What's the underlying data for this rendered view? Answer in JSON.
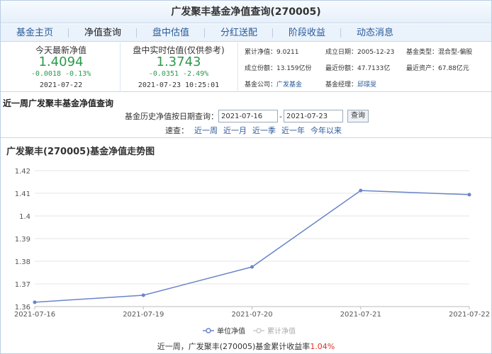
{
  "title": "广发聚丰基金净值查询(270005)",
  "nav": [
    "基金主页",
    "净值查询",
    "盘中估值",
    "分红送配",
    "阶段收益",
    "动态消息"
  ],
  "nav_active": 1,
  "today_nav": {
    "label": "今天最新净值",
    "value": "1.4094",
    "change": "-0.0018 -0.13%",
    "date": "2021-07-22"
  },
  "realtime_est": {
    "label": "盘中实时估值(仅供参考)",
    "value": "1.3743",
    "change": "-0.0351 -2.49%",
    "datetime": "2021-07-23 10:25:01"
  },
  "info": {
    "cum_nav_label": "累计净值：",
    "cum_nav": "9.0211",
    "found_date_label": "成立日期：",
    "found_date": "2005-12-23",
    "fund_type_label": "基金类型：",
    "fund_type": "混合型-偏股",
    "found_shares_label": "成立份额：",
    "found_shares": "13.159亿份",
    "recent_shares_label": "最近份额：",
    "recent_shares": "47.7133亿",
    "recent_assets_label": "最近资产：",
    "recent_assets": "67.88亿元",
    "company_label": "基金公司：",
    "company": "广发基金",
    "manager_label": "基金经理：",
    "manager": "邱璟旻"
  },
  "section_title": "近一周广发聚丰基金净值查询",
  "query": {
    "label": "基金历史净值按日期查询：",
    "start": "2021-07-16",
    "sep": "-",
    "end": "2021-07-23",
    "button": "查询"
  },
  "speed": {
    "label": "速查：",
    "links": [
      "近一周",
      "近一月",
      "近一季",
      "近一年",
      "今年以来"
    ]
  },
  "colors": {
    "accent": "#2a5a9a",
    "up": "#e0302a",
    "down": "#2a9a4a",
    "line": "#6a84c8"
  },
  "chart_data": {
    "type": "line",
    "title": "广发聚丰(270005)基金净值走势图",
    "x": [
      "2021-07-16",
      "2021-07-19",
      "2021-07-20",
      "2021-07-21",
      "2021-07-22"
    ],
    "series": [
      {
        "name": "单位净值",
        "values": [
          1.3619,
          1.365,
          1.3775,
          1.4112,
          1.4094
        ]
      }
    ],
    "legend_inactive": "累计净值",
    "ylim": [
      1.36,
      1.42
    ],
    "yticks": [
      "1.42",
      "1.41",
      "1.4",
      "1.39",
      "1.38",
      "1.37",
      "1.36"
    ],
    "grid": "horizontal",
    "legend": "bottom-center"
  },
  "footer": {
    "text": "近一周，广发聚丰(270005)基金累计收益率",
    "value": "1.04%"
  }
}
